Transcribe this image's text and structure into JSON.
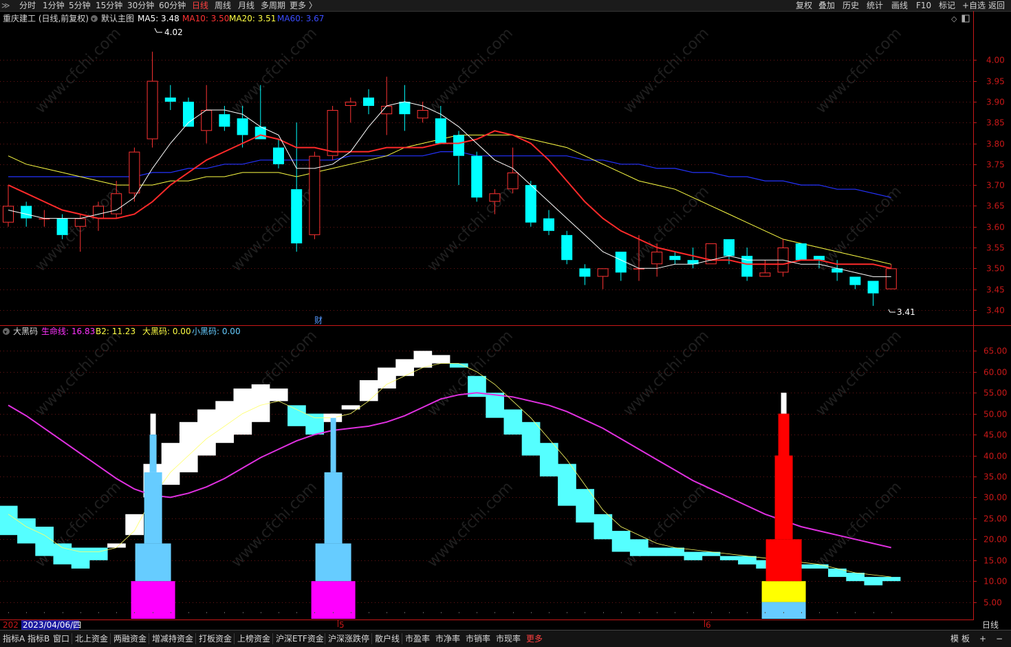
{
  "top_menu": {
    "left": [
      "分时",
      "1分钟",
      "5分钟",
      "15分钟",
      "30分钟",
      "60分钟",
      "日线",
      "周线",
      "月线",
      "多周期",
      "更多 〉"
    ],
    "active": "日线",
    "right": [
      "复权",
      "叠加",
      "历史",
      "统计",
      "画线",
      "F10",
      "标记",
      "+自选",
      "返回"
    ]
  },
  "main_legend": {
    "stock": "重庆建工 (日线,前复权)",
    "template": "默认主图",
    "ma": [
      {
        "label": "MA5: 3.48",
        "color": "#ffffff"
      },
      {
        "label": "MA10: 3.50",
        "color": "#ff3333"
      },
      {
        "label": "MA20: 3.51",
        "color": "#ffff44"
      },
      {
        "label": "MA60: 3.67",
        "color": "#3a4cff"
      }
    ]
  },
  "sub_legend": {
    "name": "大黑码",
    "items": [
      {
        "label": "生命线: 16.83",
        "color": "#ff33ff"
      },
      {
        "label": "B2: 11.23",
        "color": "#ffff44"
      },
      {
        "label": "大黑码: 0.00",
        "color": "#ffff44"
      },
      {
        "label": "小黑码: 0.00",
        "color": "#66ccff"
      }
    ]
  },
  "annotations": {
    "high": "4.02",
    "low": "3.41",
    "cai": "财"
  },
  "date_axis": {
    "cursor": "2023/04/06/四",
    "prefix": "202",
    "months": [
      "5",
      "6"
    ],
    "period": "日线"
  },
  "colors": {
    "up": "#ff3333",
    "down": "#00ffff",
    "axis_red": "#c81818",
    "grid": "#6b1515",
    "magenta": "#ff33ff",
    "lightblue": "#66ccff",
    "yellow": "#ffff00"
  },
  "bottom_tabs": [
    "指标A",
    "指标B",
    "窗口",
    "北上资金",
    "两融资金",
    "增减持资金",
    "打板资金",
    "上榜资金",
    "沪深ETF资金",
    "沪深涨跌停",
    "散户线",
    "市盈率",
    "市净率",
    "市销率",
    "市现率",
    "更多"
  ],
  "bottom_right": [
    "模",
    "板",
    "+",
    "−"
  ],
  "watermark": "www.cfchi.com",
  "chart_data": [
    {
      "type": "candlestick",
      "yaxis_labels": [
        "4.00",
        "3.95",
        "3.90",
        "3.85",
        "3.80",
        "3.75",
        "3.70",
        "3.65",
        "3.60",
        "3.55",
        "3.50",
        "3.45",
        "3.40"
      ],
      "ylim": [
        3.385,
        4.055
      ],
      "candles": [
        {
          "o": 3.61,
          "h": 3.7,
          "l": 3.6,
          "c": 3.65
        },
        {
          "o": 3.65,
          "h": 3.66,
          "l": 3.6,
          "c": 3.62
        },
        {
          "o": 3.62,
          "h": 3.64,
          "l": 3.6,
          "c": 3.62
        },
        {
          "o": 3.62,
          "h": 3.63,
          "l": 3.57,
          "c": 3.58
        },
        {
          "o": 3.6,
          "h": 3.63,
          "l": 3.54,
          "c": 3.62
        },
        {
          "o": 3.62,
          "h": 3.66,
          "l": 3.59,
          "c": 3.65
        },
        {
          "o": 3.63,
          "h": 3.71,
          "l": 3.62,
          "c": 3.68
        },
        {
          "o": 3.68,
          "h": 3.79,
          "l": 3.66,
          "c": 3.78
        },
        {
          "o": 3.81,
          "h": 4.02,
          "l": 3.79,
          "c": 3.95
        },
        {
          "o": 3.91,
          "h": 3.94,
          "l": 3.88,
          "c": 3.9
        },
        {
          "o": 3.9,
          "h": 3.91,
          "l": 3.84,
          "c": 3.84
        },
        {
          "o": 3.83,
          "h": 3.94,
          "l": 3.8,
          "c": 3.88
        },
        {
          "o": 3.87,
          "h": 3.89,
          "l": 3.83,
          "c": 3.84
        },
        {
          "o": 3.86,
          "h": 3.89,
          "l": 3.79,
          "c": 3.82
        },
        {
          "o": 3.84,
          "h": 3.94,
          "l": 3.81,
          "c": 3.81
        },
        {
          "o": 3.79,
          "h": 3.81,
          "l": 3.74,
          "c": 3.75
        },
        {
          "o": 3.69,
          "h": 3.85,
          "l": 3.54,
          "c": 3.56
        },
        {
          "o": 3.58,
          "h": 3.78,
          "l": 3.57,
          "c": 3.77
        },
        {
          "o": 3.77,
          "h": 3.89,
          "l": 3.76,
          "c": 3.88
        },
        {
          "o": 3.89,
          "h": 3.91,
          "l": 3.85,
          "c": 3.9
        },
        {
          "o": 3.91,
          "h": 3.93,
          "l": 3.87,
          "c": 3.89
        },
        {
          "o": 3.87,
          "h": 3.96,
          "l": 3.82,
          "c": 3.89
        },
        {
          "o": 3.9,
          "h": 3.94,
          "l": 3.83,
          "c": 3.87
        },
        {
          "o": 3.86,
          "h": 3.9,
          "l": 3.85,
          "c": 3.88
        },
        {
          "o": 3.86,
          "h": 3.89,
          "l": 3.8,
          "c": 3.8
        },
        {
          "o": 3.82,
          "h": 3.83,
          "l": 3.7,
          "c": 3.77
        },
        {
          "o": 3.77,
          "h": 3.78,
          "l": 3.66,
          "c": 3.67
        },
        {
          "o": 3.66,
          "h": 3.69,
          "l": 3.63,
          "c": 3.68
        },
        {
          "o": 3.69,
          "h": 3.79,
          "l": 3.68,
          "c": 3.73
        },
        {
          "o": 3.7,
          "h": 3.71,
          "l": 3.6,
          "c": 3.61
        },
        {
          "o": 3.62,
          "h": 3.64,
          "l": 3.58,
          "c": 3.59
        },
        {
          "o": 3.58,
          "h": 3.59,
          "l": 3.51,
          "c": 3.52
        },
        {
          "o": 3.5,
          "h": 3.51,
          "l": 3.46,
          "c": 3.48
        },
        {
          "o": 3.48,
          "h": 3.5,
          "l": 3.45,
          "c": 3.5
        },
        {
          "o": 3.54,
          "h": 3.54,
          "l": 3.47,
          "c": 3.49
        },
        {
          "o": 3.5,
          "h": 3.58,
          "l": 3.47,
          "c": 3.5
        },
        {
          "o": 3.51,
          "h": 3.56,
          "l": 3.48,
          "c": 3.54
        },
        {
          "o": 3.53,
          "h": 3.54,
          "l": 3.51,
          "c": 3.52
        },
        {
          "o": 3.52,
          "h": 3.55,
          "l": 3.5,
          "c": 3.51
        },
        {
          "o": 3.51,
          "h": 3.56,
          "l": 3.51,
          "c": 3.56
        },
        {
          "o": 3.57,
          "h": 3.57,
          "l": 3.51,
          "c": 3.53
        },
        {
          "o": 3.53,
          "h": 3.55,
          "l": 3.47,
          "c": 3.48
        },
        {
          "o": 3.48,
          "h": 3.52,
          "l": 3.48,
          "c": 3.49
        },
        {
          "o": 3.49,
          "h": 3.57,
          "l": 3.48,
          "c": 3.55
        },
        {
          "o": 3.56,
          "h": 3.56,
          "l": 3.52,
          "c": 3.52
        },
        {
          "o": 3.53,
          "h": 3.53,
          "l": 3.5,
          "c": 3.52
        },
        {
          "o": 3.5,
          "h": 3.52,
          "l": 3.47,
          "c": 3.49
        },
        {
          "o": 3.48,
          "h": 3.48,
          "l": 3.45,
          "c": 3.46
        },
        {
          "o": 3.47,
          "h": 3.47,
          "l": 3.41,
          "c": 3.44
        },
        {
          "o": 3.45,
          "h": 3.51,
          "l": 3.45,
          "c": 3.5
        }
      ],
      "ma5": [
        3.64,
        3.63,
        3.62,
        3.62,
        3.62,
        3.63,
        3.64,
        3.67,
        3.74,
        3.8,
        3.85,
        3.88,
        3.88,
        3.87,
        3.84,
        3.82,
        3.74,
        3.74,
        3.75,
        3.78,
        3.84,
        3.89,
        3.9,
        3.89,
        3.87,
        3.84,
        3.8,
        3.76,
        3.74,
        3.7,
        3.66,
        3.62,
        3.58,
        3.54,
        3.52,
        3.5,
        3.5,
        3.51,
        3.51,
        3.52,
        3.53,
        3.52,
        3.52,
        3.52,
        3.51,
        3.51,
        3.5,
        3.49,
        3.48,
        3.48
      ],
      "ma10": [
        3.7,
        3.68,
        3.66,
        3.64,
        3.63,
        3.62,
        3.62,
        3.63,
        3.66,
        3.7,
        3.73,
        3.76,
        3.78,
        3.8,
        3.82,
        3.81,
        3.79,
        3.79,
        3.78,
        3.78,
        3.78,
        3.79,
        3.79,
        3.79,
        3.8,
        3.8,
        3.81,
        3.83,
        3.82,
        3.8,
        3.76,
        3.71,
        3.66,
        3.62,
        3.59,
        3.57,
        3.55,
        3.54,
        3.53,
        3.52,
        3.52,
        3.51,
        3.51,
        3.51,
        3.52,
        3.52,
        3.51,
        3.51,
        3.51,
        3.5
      ],
      "ma20": [
        3.77,
        3.75,
        3.74,
        3.73,
        3.72,
        3.71,
        3.7,
        3.7,
        3.7,
        3.71,
        3.71,
        3.72,
        3.72,
        3.73,
        3.73,
        3.73,
        3.72,
        3.73,
        3.74,
        3.75,
        3.76,
        3.77,
        3.79,
        3.8,
        3.81,
        3.82,
        3.82,
        3.82,
        3.82,
        3.81,
        3.8,
        3.79,
        3.77,
        3.75,
        3.73,
        3.71,
        3.7,
        3.69,
        3.67,
        3.65,
        3.63,
        3.61,
        3.59,
        3.57,
        3.56,
        3.55,
        3.54,
        3.53,
        3.52,
        3.51
      ],
      "ma60": [
        3.72,
        3.72,
        3.72,
        3.72,
        3.72,
        3.72,
        3.72,
        3.72,
        3.73,
        3.73,
        3.74,
        3.74,
        3.75,
        3.75,
        3.76,
        3.76,
        3.76,
        3.76,
        3.76,
        3.77,
        3.77,
        3.77,
        3.77,
        3.77,
        3.78,
        3.78,
        3.77,
        3.77,
        3.77,
        3.77,
        3.77,
        3.77,
        3.76,
        3.76,
        3.75,
        3.75,
        3.74,
        3.74,
        3.73,
        3.73,
        3.72,
        3.72,
        3.71,
        3.71,
        3.7,
        3.7,
        3.69,
        3.69,
        3.68,
        3.67
      ]
    },
    {
      "type": "indicator",
      "yaxis_labels": [
        "65.00",
        "60.00",
        "55.00",
        "50.00",
        "45.00",
        "40.00",
        "35.00",
        "30.00",
        "25.00",
        "20.00",
        "15.00",
        "10.00",
        "5.00"
      ],
      "ylim": [
        1.0,
        68.0
      ],
      "bands": [
        {
          "t": 28,
          "b": 21,
          "c": "#55ffff"
        },
        {
          "t": 25,
          "b": 19,
          "c": "#55ffff"
        },
        {
          "t": 23,
          "b": 16,
          "c": "#55ffff"
        },
        {
          "t": 19,
          "b": 14,
          "c": "#55ffff"
        },
        {
          "t": 18,
          "b": 13,
          "c": "#55ffff"
        },
        {
          "t": 18,
          "b": 15,
          "c": "#55ffff"
        },
        {
          "t": 19,
          "b": 18,
          "c": "#ffffff"
        },
        {
          "t": 26,
          "b": 21,
          "c": "#ffffff"
        },
        {
          "t": 38,
          "b": 30,
          "c": "#ffffff"
        },
        {
          "t": 43,
          "b": 33,
          "c": "#ffffff"
        },
        {
          "t": 48,
          "b": 36,
          "c": "#ffffff"
        },
        {
          "t": 51,
          "b": 40,
          "c": "#ffffff"
        },
        {
          "t": 53,
          "b": 43,
          "c": "#ffffff"
        },
        {
          "t": 56,
          "b": 45,
          "c": "#ffffff"
        },
        {
          "t": 57,
          "b": 48,
          "c": "#ffffff"
        },
        {
          "t": 56,
          "b": 53,
          "c": "#ffffff"
        },
        {
          "t": 52,
          "b": 47,
          "c": "#55ffff"
        },
        {
          "t": 50,
          "b": 45,
          "c": "#55ffff"
        },
        {
          "t": 50,
          "b": 48,
          "c": "#ffffff"
        },
        {
          "t": 52,
          "b": 51,
          "c": "#ffffff"
        },
        {
          "t": 58,
          "b": 53,
          "c": "#ffffff"
        },
        {
          "t": 61,
          "b": 56,
          "c": "#ffffff"
        },
        {
          "t": 63,
          "b": 59,
          "c": "#ffffff"
        },
        {
          "t": 65,
          "b": 61,
          "c": "#ffffff"
        },
        {
          "t": 64,
          "b": 62,
          "c": "#ffffff"
        },
        {
          "t": 62,
          "b": 61,
          "c": "#55ffff"
        },
        {
          "t": 59,
          "b": 54,
          "c": "#55ffff"
        },
        {
          "t": 55,
          "b": 49,
          "c": "#55ffff"
        },
        {
          "t": 51,
          "b": 45,
          "c": "#55ffff"
        },
        {
          "t": 48,
          "b": 40,
          "c": "#55ffff"
        },
        {
          "t": 43,
          "b": 35,
          "c": "#55ffff"
        },
        {
          "t": 38,
          "b": 28,
          "c": "#55ffff"
        },
        {
          "t": 32,
          "b": 24,
          "c": "#55ffff"
        },
        {
          "t": 26,
          "b": 20,
          "c": "#55ffff"
        },
        {
          "t": 22,
          "b": 17,
          "c": "#55ffff"
        },
        {
          "t": 20,
          "b": 16,
          "c": "#55ffff"
        },
        {
          "t": 18,
          "b": 16,
          "c": "#55ffff"
        },
        {
          "t": 18,
          "b": 16,
          "c": "#55ffff"
        },
        {
          "t": 17,
          "b": 15,
          "c": "#55ffff"
        },
        {
          "t": 17,
          "b": 16,
          "c": "#55ffff"
        },
        {
          "t": 16,
          "b": 15,
          "c": "#55ffff"
        },
        {
          "t": 16,
          "b": 14,
          "c": "#55ffff"
        },
        {
          "t": 15,
          "b": 13,
          "c": "#55ffff"
        },
        {
          "t": 15,
          "b": 13,
          "c": "#55ffff"
        },
        {
          "t": 14,
          "b": 13,
          "c": "#55ffff"
        },
        {
          "t": 14,
          "b": 13,
          "c": "#55ffff"
        },
        {
          "t": 13,
          "b": 11,
          "c": "#55ffff"
        },
        {
          "t": 12,
          "b": 10,
          "c": "#55ffff"
        },
        {
          "t": 11,
          "b": 9,
          "c": "#55ffff"
        },
        {
          "t": 11,
          "b": 10,
          "c": "#55ffff"
        }
      ],
      "lifeline": [
        52,
        49.5,
        46.5,
        43.5,
        40.5,
        37.5,
        34.5,
        32,
        30.5,
        30,
        31,
        32.5,
        34.5,
        37,
        39.5,
        41.5,
        43.5,
        45,
        46,
        46.5,
        47,
        48,
        49.5,
        51.5,
        53.5,
        54.5,
        55,
        54.5,
        54,
        53,
        52,
        50.5,
        48.5,
        46.5,
        44,
        41.5,
        39,
        36.5,
        34,
        32,
        30,
        28,
        26,
        24.5,
        23,
        22,
        21,
        20,
        19,
        18
      ],
      "b2": [
        26,
        23,
        21,
        18,
        17,
        17,
        18,
        22,
        30,
        36,
        40,
        44,
        47,
        50,
        52,
        53,
        51,
        49,
        49,
        50,
        53,
        57,
        59,
        61,
        62,
        62,
        60,
        57,
        53,
        49,
        44,
        39,
        33,
        27,
        23,
        21,
        19,
        18,
        17.5,
        17,
        16.5,
        16,
        15.5,
        15,
        14.5,
        14,
        13,
        12,
        11.5,
        11
      ],
      "spikes": [
        {
          "idx": 8,
          "segs": [
            {
              "lo": 1,
              "hi": 10,
              "w": 64,
              "c": "#ff00ff"
            },
            {
              "lo": 10,
              "hi": 19,
              "w": 52,
              "c": "#66ccff"
            },
            {
              "lo": 19,
              "hi": 36,
              "w": 26,
              "c": "#66ccff"
            },
            {
              "lo": 36,
              "hi": 45,
              "w": 10,
              "c": "#66ccff"
            },
            {
              "lo": 45,
              "hi": 50,
              "w": 8,
              "c": "#ffffff"
            }
          ]
        },
        {
          "idx": 18,
          "segs": [
            {
              "lo": 1,
              "hi": 10,
              "w": 64,
              "c": "#ff00ff"
            },
            {
              "lo": 10,
              "hi": 19,
              "w": 52,
              "c": "#66ccff"
            },
            {
              "lo": 19,
              "hi": 36,
              "w": 26,
              "c": "#66ccff"
            },
            {
              "lo": 36,
              "hi": 49,
              "w": 8,
              "c": "#66ccff"
            },
            {
              "lo": 49,
              "hi": 50,
              "w": 8,
              "c": "#ffffff"
            }
          ]
        },
        {
          "idx": 43,
          "segs": [
            {
              "lo": 1,
              "hi": 5,
              "w": 64,
              "c": "#66ccff"
            },
            {
              "lo": 5,
              "hi": 10,
              "w": 64,
              "c": "#ffff00"
            },
            {
              "lo": 10,
              "hi": 20,
              "w": 52,
              "c": "#ff0000"
            },
            {
              "lo": 20,
              "hi": 40,
              "w": 26,
              "c": "#ff0000"
            },
            {
              "lo": 40,
              "hi": 50,
              "w": 16,
              "c": "#ff0000"
            },
            {
              "lo": 50,
              "hi": 55,
              "w": 8,
              "c": "#ffffff"
            }
          ]
        }
      ]
    }
  ]
}
